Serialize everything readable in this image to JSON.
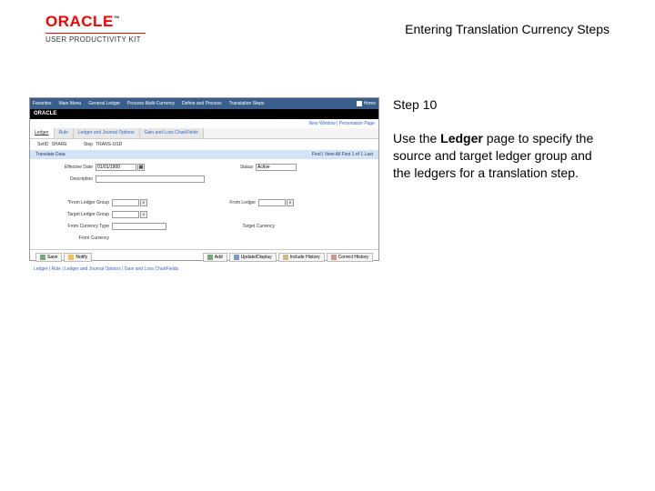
{
  "header": {
    "brand": "ORACLE",
    "subbrand": "USER PRODUCTIVITY KIT",
    "title": "Entering Translation Currency Steps"
  },
  "sidebar": {
    "step_label": "Step 10",
    "text_pre": "Use the ",
    "text_bold": "Ledger",
    "text_post": " page to specify the source and target ledger group and the ledgers for a translation step."
  },
  "ss": {
    "nav": {
      "n1": "Favorites",
      "n2": "Main Menu",
      "n3": "General Ledger",
      "n4": "Process Multi-Currency",
      "n5": "Define and Process",
      "n6": "Translation Steps",
      "home": "Home"
    },
    "brandbar": "ORACLE",
    "sublinks": "New Window | Personalize Page",
    "tabs": {
      "t1": "Ledger",
      "t2": "Rule",
      "t3": "Ledger and Journal Options",
      "t4": "Gain and Loss ChartFields"
    },
    "info": {
      "setid_l": "SetID",
      "setid_v": "SHARE",
      "step_l": "Step",
      "step_v": "TRANS-USD",
      "eff_l": "Effective Date",
      "eff_v": "01/01/1900"
    },
    "section": {
      "title": "Translate Data",
      "right": "Find | View All    First  1 of 1  Last"
    },
    "form": {
      "effdate_l": "Effective Date",
      "effdate_v": "01/01/1900",
      "status_l": "Status",
      "status_v": "Active",
      "desc_l": "Description",
      "from_grp_l": "*From Ledger Group",
      "from_ldg_l": "From Ledger",
      "tgt_grp_l": "Target Ledger Group",
      "fct_l": "From Currency Type",
      "tgt_cur_l": "Target Currency",
      "fc_l": "From Currency"
    },
    "buttons": {
      "save": "Save",
      "notify": "Notify",
      "add": "Add",
      "upd": "Update/Display",
      "inc": "Include History",
      "cor": "Correct History"
    },
    "footer": "Ledger | Rule | Ledger and Journal Options | Gain and Loss ChartFields"
  }
}
